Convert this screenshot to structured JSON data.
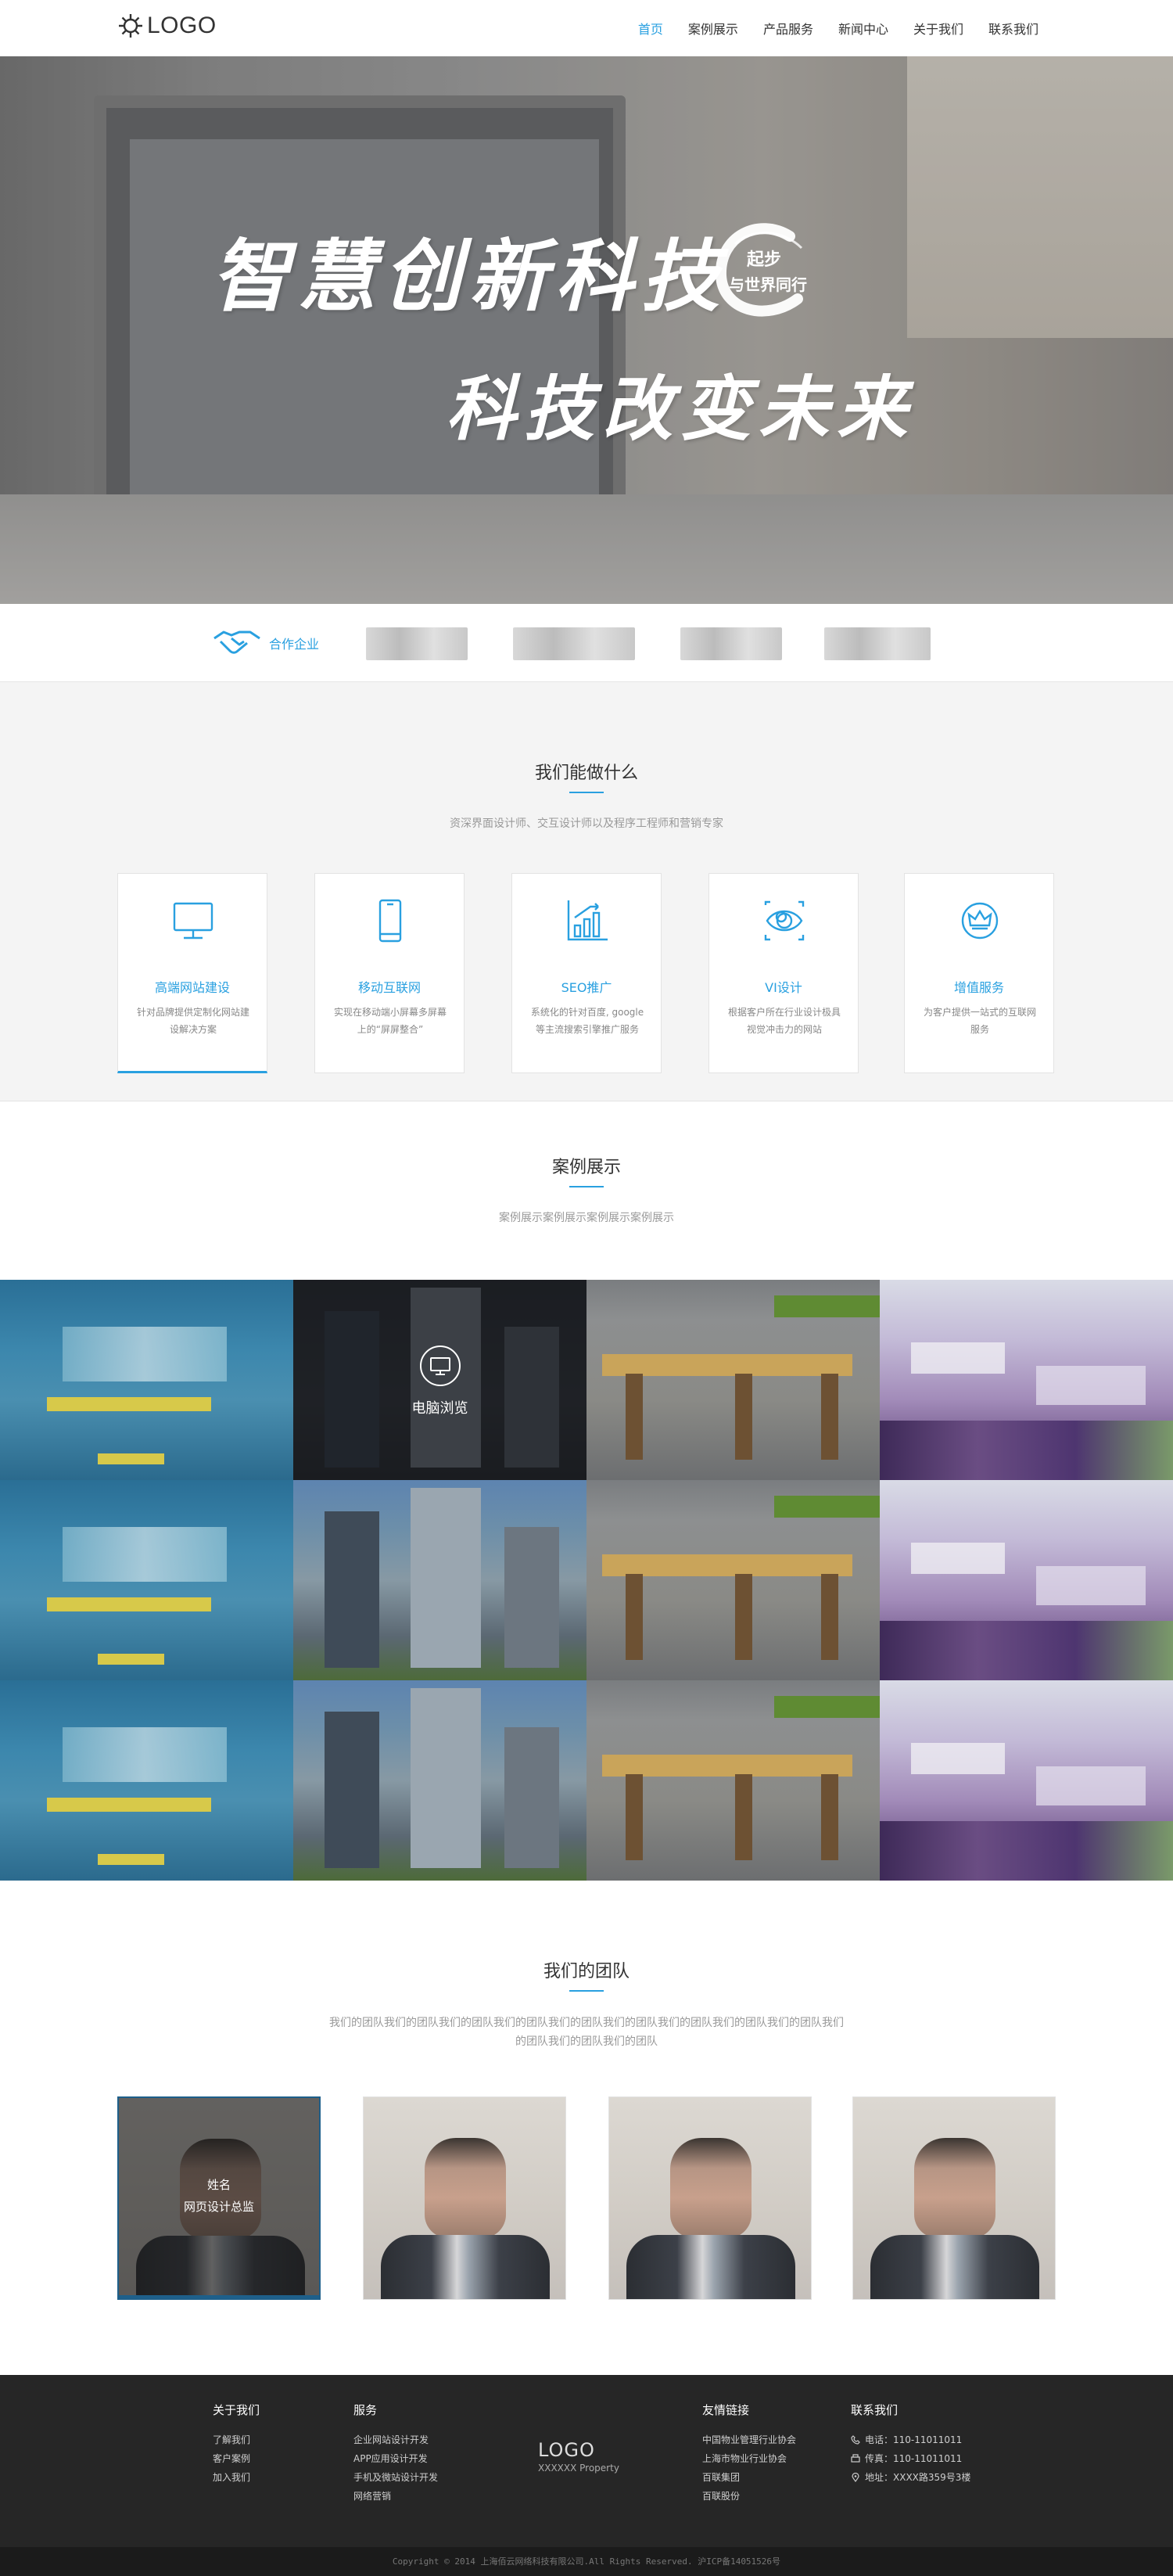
{
  "header": {
    "logo_text": "LOGO",
    "nav": [
      "首页",
      "案例展示",
      "产品服务",
      "新闻中心",
      "关于我们",
      "联系我们"
    ]
  },
  "hero": {
    "line1": "智慧创新科技",
    "line2": "科技改变未来",
    "stamp_top": "起步",
    "stamp_bottom": "与世界同行"
  },
  "partners": {
    "label": "合作企业"
  },
  "services": {
    "title": "我们能做什么",
    "subtitle": "资深界面设计师、交互设计师以及程序工程师和营销专家",
    "items": [
      {
        "title": "高端网站建设",
        "desc": "针对品牌提供定制化网站建设解决方案",
        "icon": "desktop-icon"
      },
      {
        "title": "移动互联网",
        "desc": "实现在移动端小屏幕多屏幕上的“屏屏整合”",
        "icon": "mobile-icon"
      },
      {
        "title": "SEO推广",
        "desc": "系统化的针对百度, google等主流搜索引擎推广服务",
        "icon": "chart-icon"
      },
      {
        "title": "VI设计",
        "desc": "根据客户所在行业设计极具视觉冲击力的网站",
        "icon": "eye-icon"
      },
      {
        "title": "增值服务",
        "desc": "为客户提供一站式的互联网服务",
        "icon": "crown-icon"
      }
    ]
  },
  "cases": {
    "title": "案例展示",
    "subtitle": "案例展示案例展示案例展示案例展示",
    "hover_label": "电脑浏览"
  },
  "team": {
    "title": "我们的团队",
    "desc": "我们的团队我们的团队我们的团队我们的团队我们的团队我们的团队我们的团队我们的团队我们的团队我们的团队我们的团队我们的团队",
    "active_member": {
      "name": "姓名",
      "role": "网页设计总监"
    }
  },
  "footer": {
    "about": {
      "title": "关于我们",
      "items": [
        "了解我们",
        "客户案例",
        "加入我们"
      ]
    },
    "service": {
      "title": "服务",
      "items": [
        "企业网站设计开发",
        "APP应用设计开发",
        "手机及微站设计开发",
        "网络营销"
      ]
    },
    "logo": {
      "text": "LOGO",
      "sub": "XXXXXX Property"
    },
    "links": {
      "title": "友情链接",
      "items": [
        "中国物业管理行业协会",
        "上海市物业行业协会",
        "百联集团",
        "百联股份"
      ]
    },
    "contact": {
      "title": "联系我们",
      "phone": "电话：110-11011011",
      "fax": "传真：110-11011011",
      "address": "地址：XXXX路359号3楼"
    },
    "copyright": "Copyright © 2014 上海佰云网络科技有限公司.All Rights Reserved. 沪ICP备14051526号"
  },
  "colors": {
    "accent": "#29a0e0",
    "footer_bg": "#262626",
    "team_active": "#1e5f8a"
  }
}
